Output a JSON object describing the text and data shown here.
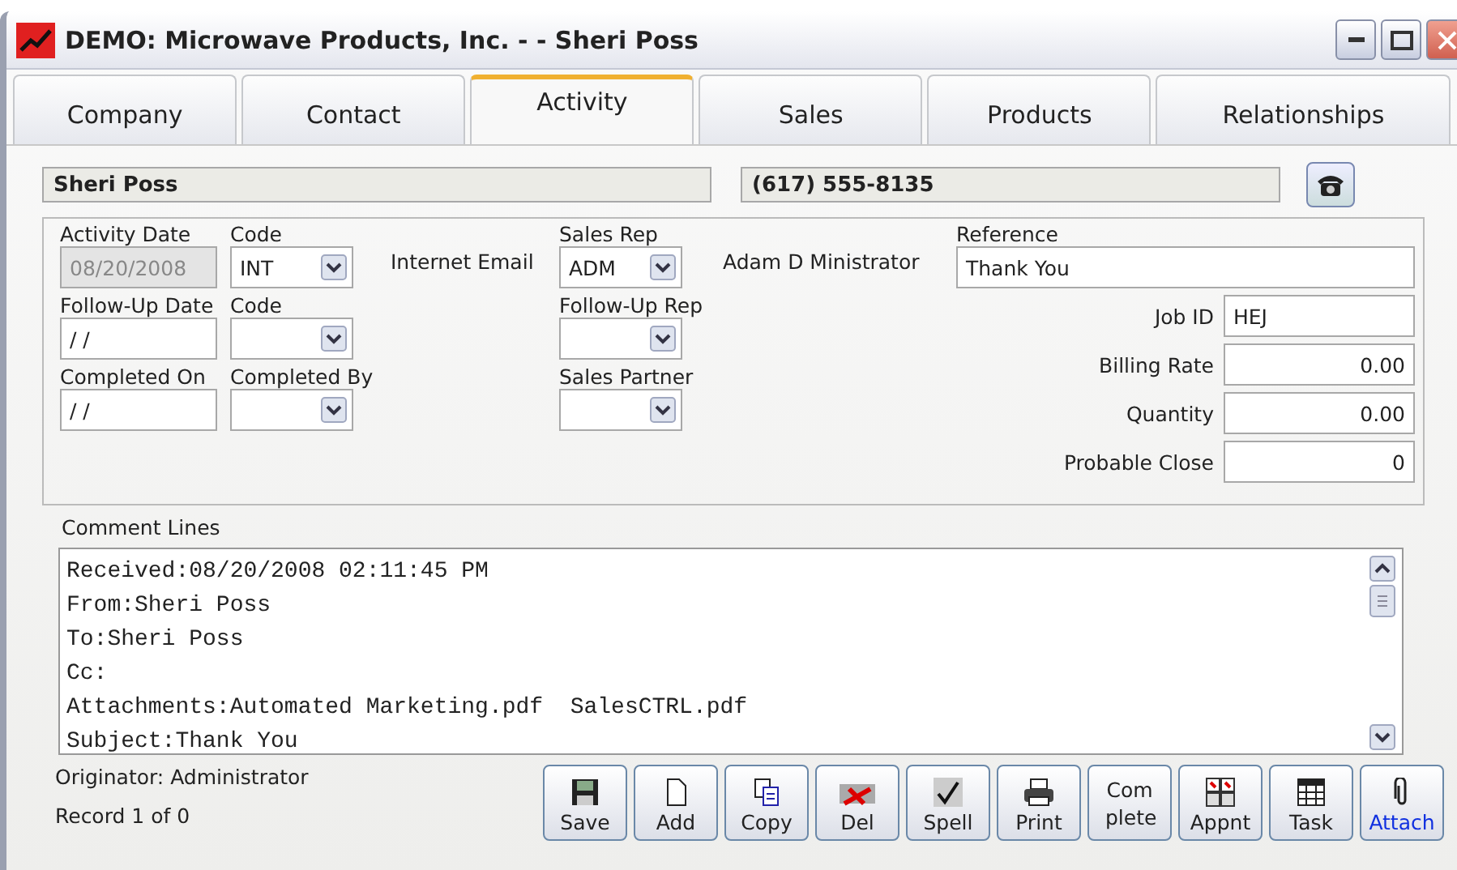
{
  "window": {
    "title": "DEMO:  Microwave Products, Inc. - - Sheri Poss"
  },
  "tabs": [
    {
      "label": "Company",
      "selected": false
    },
    {
      "label": "Contact",
      "selected": false
    },
    {
      "label": "Activity",
      "selected": true
    },
    {
      "label": "Sales",
      "selected": false
    },
    {
      "label": "Products",
      "selected": false
    },
    {
      "label": "Relationships",
      "selected": false
    }
  ],
  "contact_name": "Sheri Poss",
  "phone": "(617) 555-8135",
  "left_rows": [
    {
      "date": {
        "label": "Activity Date",
        "value": "08/20/2008",
        "disabled": true
      },
      "code": {
        "label": "Code",
        "value": "INT"
      },
      "description": "Internet Email",
      "rep": {
        "label": "Sales Rep",
        "value": "ADM"
      },
      "rep_name": "Adam D Ministrator"
    },
    {
      "date": {
        "label": "Follow-Up Date",
        "value": "/ /",
        "disabled": false
      },
      "code": {
        "label": "Code"
      },
      "rep": {
        "label": "Follow-Up Rep"
      }
    },
    {
      "date": {
        "label": "Completed On",
        "value": "/ /",
        "disabled": false
      },
      "code": {
        "label": "Completed By"
      },
      "rep": {
        "label": "Sales Partner"
      }
    }
  ],
  "reference": {
    "label": "Reference",
    "value": "Thank You"
  },
  "right_fields": [
    {
      "label": "Job ID",
      "value": "HEJ",
      "kind": "text"
    },
    {
      "label": "Billing Rate",
      "value": "0.00",
      "kind": "number"
    },
    {
      "label": "Quantity",
      "value": "0.00",
      "kind": "number"
    },
    {
      "label": "Probable Close",
      "value": "0",
      "kind": "number"
    }
  ],
  "comments": {
    "label": "Comment Lines",
    "lines": [
      "Received:08/20/2008 02:11:45 PM",
      "From:Sheri Poss",
      "To:Sheri Poss",
      "Cc:",
      "Attachments:Automated Marketing.pdf  SalesCTRL.pdf",
      "Subject:Thank You"
    ]
  },
  "originator": "Originator: Administrator",
  "record": "Record 1 of 0",
  "buttons": [
    {
      "label": "Save",
      "kind": "save",
      "link": false
    },
    {
      "label": "Add",
      "kind": "add",
      "link": false
    },
    {
      "label": "Copy",
      "kind": "copy",
      "link": false
    },
    {
      "label": "Del",
      "kind": "delete",
      "link": false
    },
    {
      "label": "Spell",
      "kind": "spell",
      "link": false
    },
    {
      "label": "Print",
      "kind": "print",
      "link": false
    },
    {
      "label": "Com plete",
      "kind": "text",
      "link": false
    },
    {
      "label": "Appnt",
      "kind": "appointment",
      "link": false
    },
    {
      "label": "Task",
      "kind": "task",
      "link": false
    },
    {
      "label": "Attach",
      "kind": "attach",
      "link": true
    }
  ]
}
